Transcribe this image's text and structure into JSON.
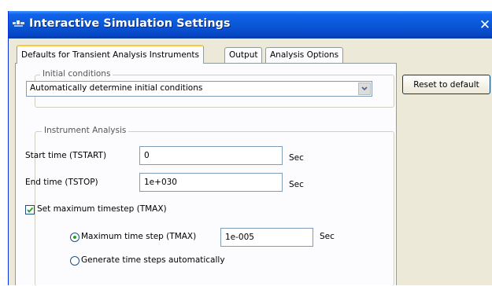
{
  "window": {
    "title": "Interactive Simulation Settings",
    "close_glyph": "✕"
  },
  "tabs": [
    {
      "label": "Defaults for Transient Analysis Instruments",
      "active": true
    },
    {
      "label": "Output",
      "active": false
    },
    {
      "label": "Analysis Options",
      "active": false
    }
  ],
  "initial_conditions": {
    "legend": "Initial conditions",
    "selected": "Automatically determine initial conditions"
  },
  "reset_button": "Reset to default",
  "instrument_analysis": {
    "legend": "Instrument Analysis",
    "start_time": {
      "label": "Start time (TSTART)",
      "value": "0",
      "unit": "Sec"
    },
    "end_time": {
      "label": "End time (TSTOP)",
      "value": "1e+030",
      "unit": "Sec"
    },
    "set_max_timestep": {
      "label": "Set maximum timestep (TMAX)",
      "checked": true
    },
    "max_time_step": {
      "label": "Maximum time step (TMAX)",
      "value": "1e-005",
      "unit": "Sec",
      "selected": true
    },
    "generate_auto": {
      "label": "Generate time steps automatically",
      "selected": false
    }
  },
  "icons": {
    "title": "app-icon",
    "close": "close-icon",
    "combo": "chevron-down-icon",
    "check": "checkmark-icon",
    "radio": "radio-dot-icon"
  },
  "colors": {
    "titlebar": "#0a58d8",
    "dialog_bg": "#ece9d8",
    "panel_bg": "#fcfcfe",
    "active_tab_accent": "#ffc83c",
    "check_green": "#21a121"
  }
}
